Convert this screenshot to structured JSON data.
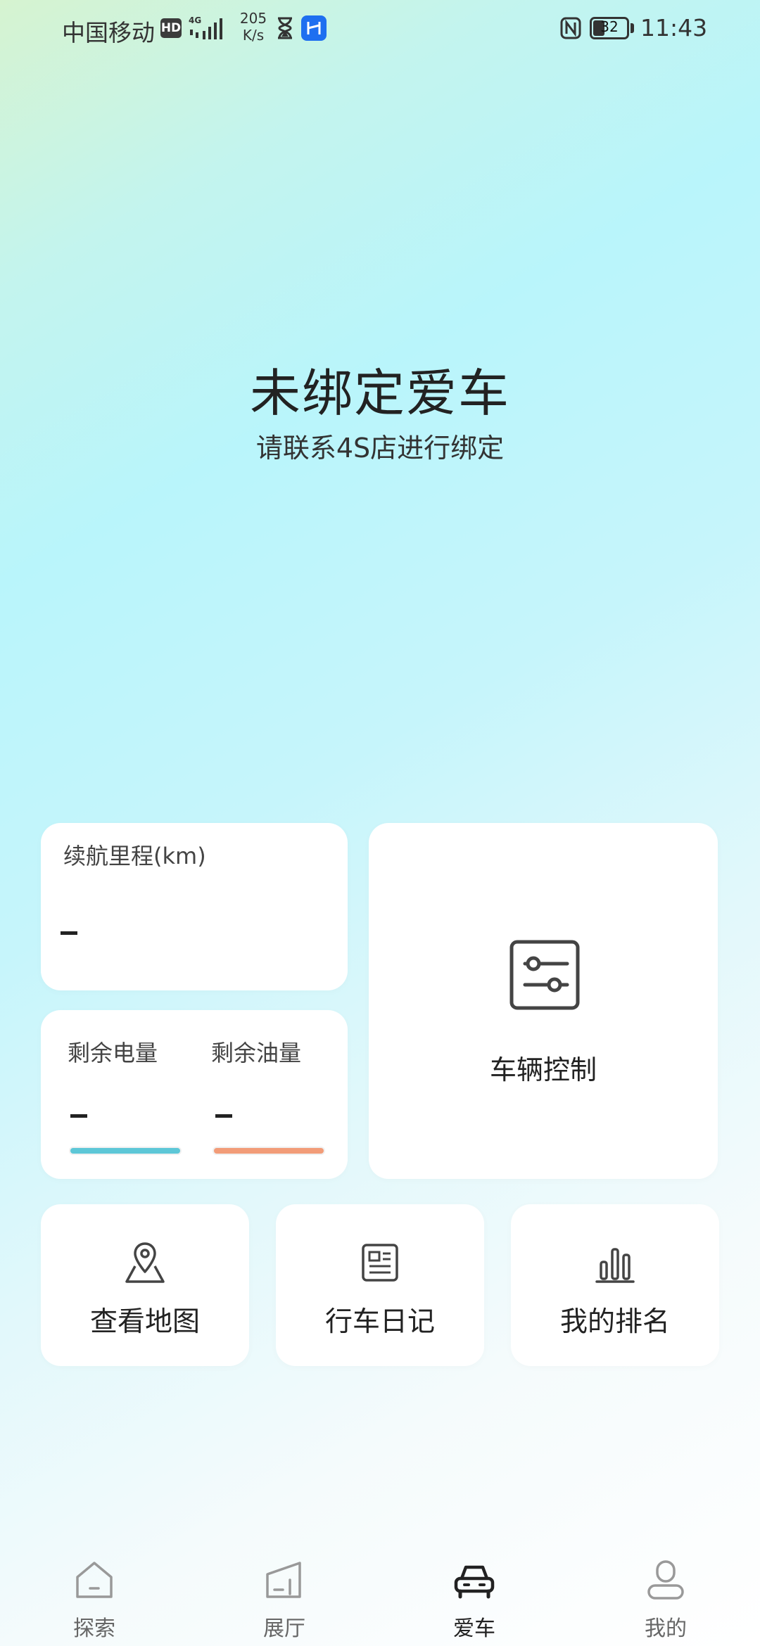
{
  "status_bar": {
    "carrier": "中国移动",
    "hd_badge": "HD",
    "network_type": "4G",
    "speed_value": "205",
    "speed_unit": "K/s",
    "battery_level": "32",
    "time": "11:43"
  },
  "hero": {
    "title": "未绑定爱车",
    "subtitle": "请联系4S店进行绑定"
  },
  "range_card": {
    "label": "续航里程(km)",
    "value": "–"
  },
  "energy_card": {
    "electricity_label": "剩余电量",
    "electricity_value": "–",
    "electricity_percent": 100,
    "fuel_label": "剩余油量",
    "fuel_value": "–",
    "fuel_percent": 100
  },
  "control_card": {
    "label": "车辆控制",
    "icon": "sliders-icon"
  },
  "shortcuts": [
    {
      "label": "查看地图",
      "icon": "map-pin-icon"
    },
    {
      "label": "行车日记",
      "icon": "journal-icon"
    },
    {
      "label": "我的排名",
      "icon": "bar-chart-icon"
    }
  ],
  "bottom_nav": [
    {
      "label": "探索",
      "icon": "home-icon",
      "active": false
    },
    {
      "label": "展厅",
      "icon": "showroom-icon",
      "active": false
    },
    {
      "label": "爱车",
      "icon": "car-icon",
      "active": true
    },
    {
      "label": "我的",
      "icon": "profile-icon",
      "active": false
    }
  ],
  "colors": {
    "electricity_bar": "#5dc7d7",
    "fuel_bar": "#f29c78",
    "icon_stroke": "#444444",
    "icon_inactive": "#999999",
    "active_nav": "#222222"
  }
}
